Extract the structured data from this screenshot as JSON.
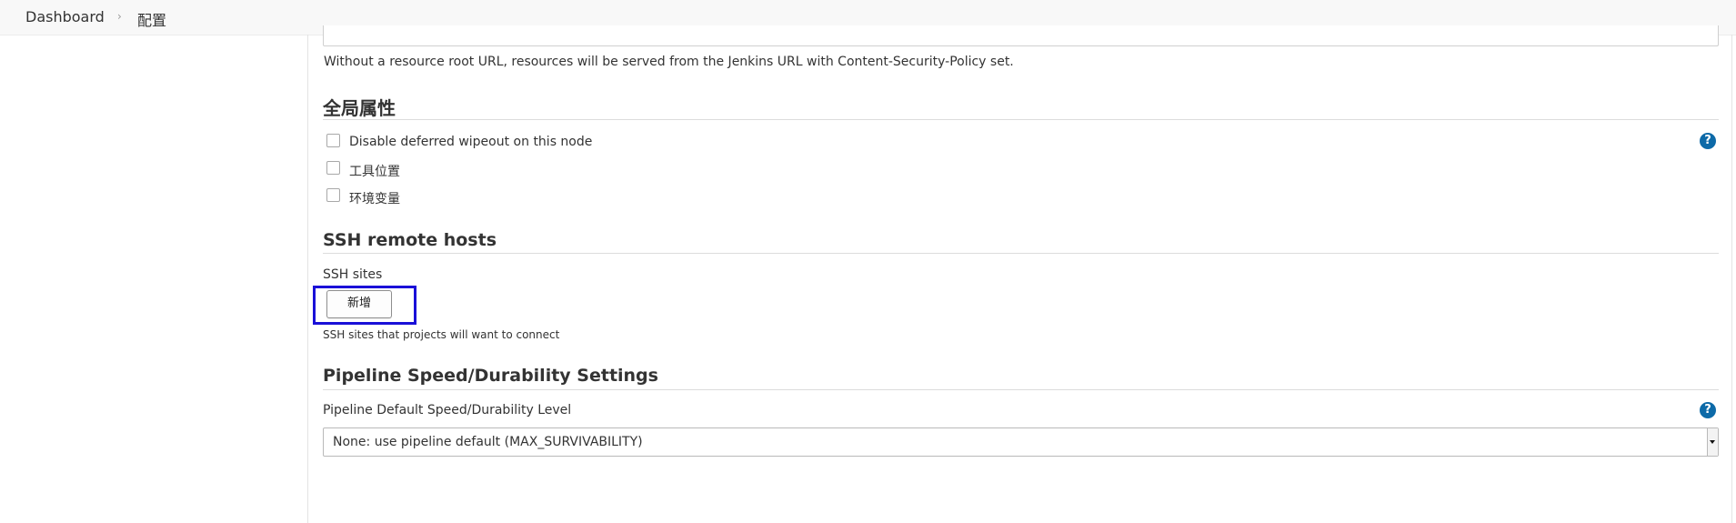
{
  "breadcrumb": {
    "items": [
      "Dashboard",
      "配置"
    ],
    "separator": "›"
  },
  "resource_root": {
    "help_text": "Without a resource root URL, resources will be served from the Jenkins URL with Content-Security-Policy set."
  },
  "global_properties": {
    "title": "全局属性",
    "checkboxes": [
      {
        "label": "Disable deferred wipeout on this node",
        "checked": false
      },
      {
        "label": "工具位置",
        "checked": false
      },
      {
        "label": "环境变量",
        "checked": false
      }
    ],
    "help_icon": "?"
  },
  "ssh": {
    "title": "SSH remote hosts",
    "field_label": "SSH sites",
    "add_button": "新增",
    "help_text": "SSH sites that projects will want to connect"
  },
  "pipeline": {
    "title": "Pipeline Speed/Durability Settings",
    "field_label": "Pipeline Default Speed/Durability Level",
    "help_icon": "?",
    "select_value": "None: use pipeline default (MAX_SURVIVABILITY)"
  },
  "colors": {
    "accent_highlight": "#1a10d8",
    "help_icon": "#0d6aa8"
  }
}
